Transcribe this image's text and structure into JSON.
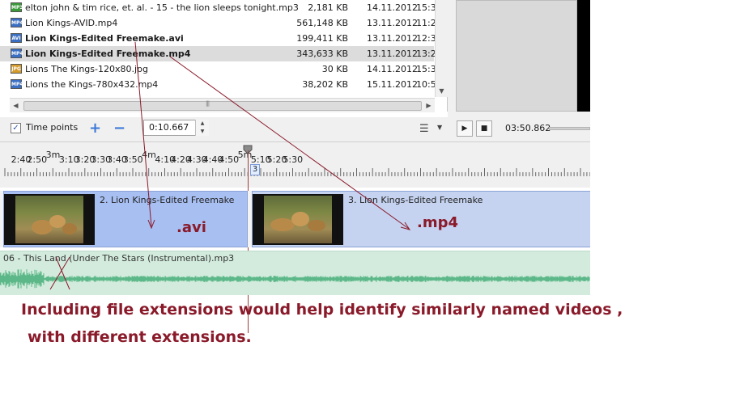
{
  "files": [
    {
      "icon": "MP3",
      "icon_color": "#3a9a3a",
      "name": "elton john & tim rice, et. al. - 15 - the lion sleeps tonight.mp3",
      "size": "2,181 KB",
      "date": "14.11.2012",
      "time": "15:3",
      "bold": false,
      "selected": false
    },
    {
      "icon": "MP4",
      "icon_color": "#3a6fc4",
      "name": "Lion Kings-AVID.mp4",
      "size": "561,148 KB",
      "date": "13.11.2012",
      "time": "11:2",
      "bold": false,
      "selected": false
    },
    {
      "icon": "AVI",
      "icon_color": "#3a6fc4",
      "name": "Lion Kings-Edited Freemake.avi",
      "size": "199,411 KB",
      "date": "13.11.2012",
      "time": "12:3",
      "bold": true,
      "selected": false
    },
    {
      "icon": "MP4",
      "icon_color": "#3a6fc4",
      "name": "Lion Kings-Edited Freemake.mp4",
      "size": "343,633 KB",
      "date": "13.11.2012",
      "time": "13:2",
      "bold": true,
      "selected": true
    },
    {
      "icon": "JPG",
      "icon_color": "#d49a2a",
      "name": "Lions The Kings-120x80.jpg",
      "size": "30 KB",
      "date": "14.11.2012",
      "time": "15:3",
      "bold": false,
      "selected": false
    },
    {
      "icon": "MP4",
      "icon_color": "#3a6fc4",
      "name": "Lions the Kings-780x432.mp4",
      "size": "38,202 KB",
      "date": "15.11.2012",
      "time": "10:5",
      "bold": false,
      "selected": false
    }
  ],
  "toolbar": {
    "time_points_label": "Time points",
    "time_points_checked": true,
    "time_value": "0:10.667",
    "timecode": "03:50.862"
  },
  "ruler": {
    "labels": [
      {
        "text": "2:40",
        "major": false
      },
      {
        "text": "2:50",
        "major": false
      },
      {
        "text": "3m",
        "major": true
      },
      {
        "text": "3:10",
        "major": false
      },
      {
        "text": "3:20",
        "major": false
      },
      {
        "text": "3:30",
        "major": false
      },
      {
        "text": "3:40",
        "major": false
      },
      {
        "text": "3:50",
        "major": false
      },
      {
        "text": "4m",
        "major": true
      },
      {
        "text": "4:10",
        "major": false
      },
      {
        "text": "4:20",
        "major": false
      },
      {
        "text": "4:30",
        "major": false
      },
      {
        "text": "4:40",
        "major": false
      },
      {
        "text": "4:50",
        "major": false
      },
      {
        "text": "5m",
        "major": true
      },
      {
        "text": "5:10",
        "major": false
      },
      {
        "text": "5:20",
        "major": false
      },
      {
        "text": "5:30",
        "major": false
      }
    ],
    "marker": "3"
  },
  "clips": [
    {
      "title": "2. Lion Kings-Edited Freemake"
    },
    {
      "title": "3. Lion Kings-Edited Freemake"
    }
  ],
  "audio": {
    "title": "06 - This Land (Under The Stars (Instrumental).mp3"
  },
  "annotations": {
    "avi": ".avi",
    "mp4": ".mp4",
    "line1": "Including file extensions would help identify similarly named videos ,",
    "line2": "with different extensions."
  },
  "colors": {
    "annotation": "#8a1a2a",
    "clip_selected": "#a8bff2",
    "clip": "#c5d3f0",
    "audio_track": "#d2ebdd",
    "waveform": "#5cb888"
  }
}
